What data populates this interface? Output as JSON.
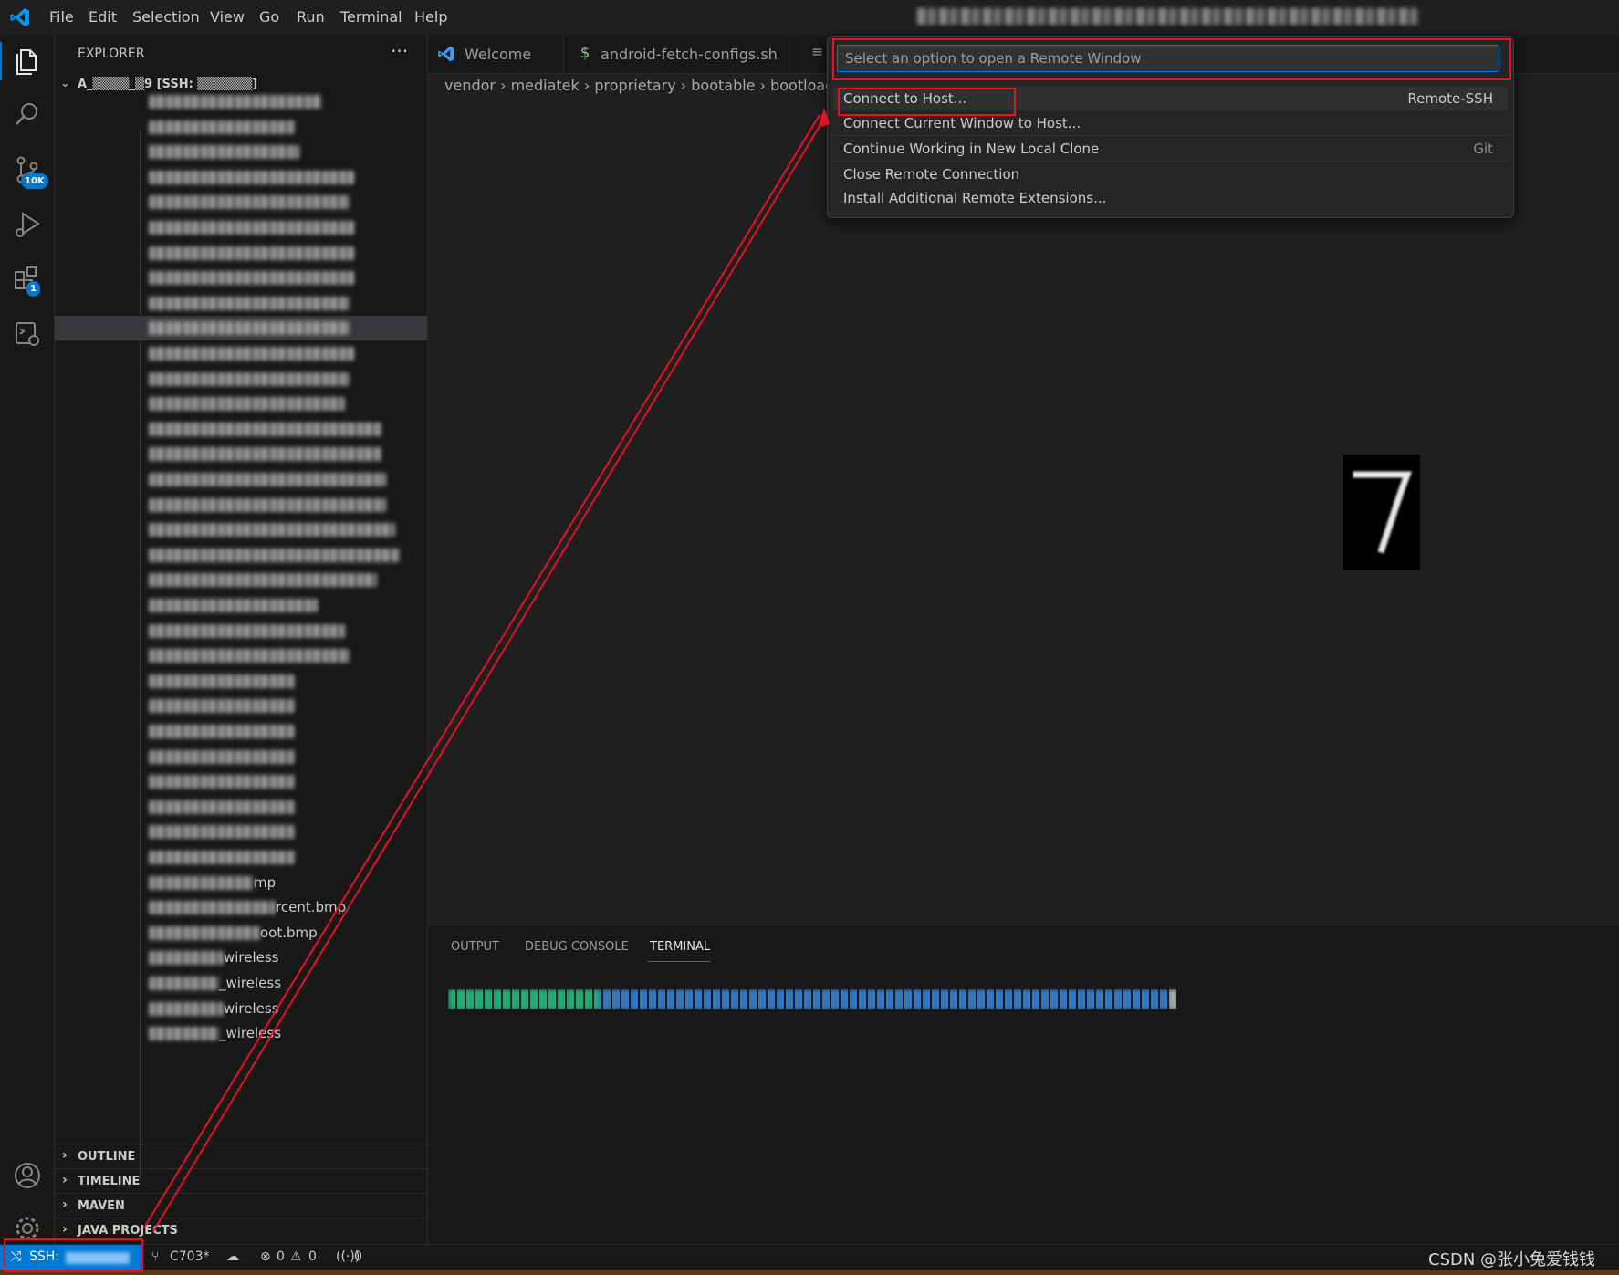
{
  "menu": {
    "items": [
      "File",
      "Edit",
      "Selection",
      "View",
      "Go",
      "Run",
      "Terminal",
      "Help"
    ]
  },
  "activity_bar": {
    "source_control_badge": "10K",
    "extensions_badge": "1"
  },
  "sidebar": {
    "title": "EXPLORER",
    "more": "···",
    "root_folder": "A_▒▒▒▒_▒9 [SSH: ▒▒▒▒▒▒]",
    "partial_file_names": [
      "mp",
      "rcent.bmp",
      "oot.bmp",
      "wireless",
      "_wireless",
      "wireless",
      "_wireless"
    ],
    "sections": [
      "OUTLINE",
      "TIMELINE",
      "MAVEN",
      "JAVA PROJECTS"
    ]
  },
  "tabs": [
    {
      "label": "Welcome",
      "icon": "vscode-logo-icon"
    },
    {
      "label": "android-fetch-configs.sh",
      "icon": "dollar-icon"
    }
  ],
  "breadcrumb": [
    "vendor",
    "mediatek",
    "proprietary",
    "bootable",
    "bootloader"
  ],
  "quick_pick": {
    "placeholder": "Select an option to open a Remote Window",
    "items": [
      {
        "label": "Connect to Host...",
        "detail": "Remote-SSH"
      },
      {
        "label": "Connect Current Window to Host...",
        "detail": ""
      },
      {
        "label": "Continue Working in New Local Clone",
        "detail": "Git"
      },
      {
        "label": "Close Remote Connection",
        "detail": ""
      },
      {
        "label": "Install Additional Remote Extensions...",
        "detail": ""
      }
    ]
  },
  "panel": {
    "tabs": [
      "OUTPUT",
      "DEBUG CONSOLE",
      "TERMINAL"
    ],
    "active_tab": "TERMINAL"
  },
  "status_bar": {
    "remote": "SSH:",
    "branch": "C703*",
    "errors": "0",
    "warnings": "0",
    "ports": "0",
    "watermark": "CSDN @张小兔爱钱钱"
  },
  "colors": {
    "accent": "#0078d4",
    "annotation": "#e81123",
    "background": "#1f1f1f"
  }
}
